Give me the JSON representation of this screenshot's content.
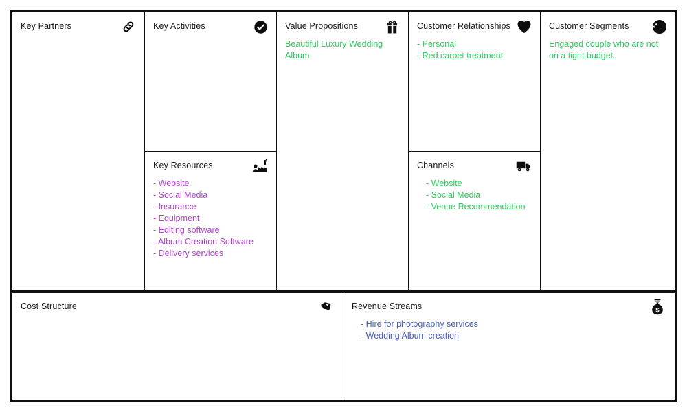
{
  "document": {
    "type": "Business Model Canvas",
    "subject": "Wedding Photography Business"
  },
  "colors": {
    "green": "#2ecc5e",
    "purple": "#b044cf",
    "blue": "#4a5ec0",
    "border": "#111111",
    "title": "#1a1a1a",
    "background": "#ffffff"
  },
  "blocks": {
    "key_partners": {
      "title": "Key Partners",
      "icon": "link-chain-icon",
      "items": [],
      "text_color": "#2ecc5e"
    },
    "key_activities": {
      "title": "Key Activities",
      "icon": "check-circle-icon",
      "items": [],
      "text_color": "#2ecc5e"
    },
    "key_resources": {
      "title": "Key Resources",
      "icon": "factory-worker-icon",
      "items": [
        "- Website",
        "- Social Media",
        "- Insurance",
        "- Equipment",
        "- Editing software",
        "- Album Creation Software",
        "- Delivery services"
      ],
      "text_color": "#b044cf"
    },
    "value_propositions": {
      "title": "Value Propositions",
      "icon": "gift-box-icon",
      "items": [
        "Beautiful Luxury Wedding Album"
      ],
      "text_color": "#2ecc5e"
    },
    "customer_relationships": {
      "title": "Customer Relationships",
      "icon": "heart-icon",
      "items": [
        "- Personal",
        "- Red carpet treatment"
      ],
      "text_color": "#2ecc5e"
    },
    "channels": {
      "title": "Channels",
      "icon": "delivery-truck-icon",
      "items": [
        "- Website",
        "- Social Media",
        "- Venue Recommendation"
      ],
      "text_color": "#2ecc5e"
    },
    "customer_segments": {
      "title": "Customer Segments",
      "icon": "customer-head-icon",
      "items": [
        "Engaged couple who are not on a tight budget."
      ],
      "text_color": "#2ecc5e"
    },
    "cost_structure": {
      "title": "Cost Structure",
      "icon": "price-tag-icon",
      "items": [],
      "text_color": "#4a5ec0"
    },
    "revenue_streams": {
      "title": "Revenue Streams",
      "icon": "money-bag-icon",
      "items": [
        "- Hire for photography services",
        "- Wedding Album creation"
      ],
      "text_color": "#4a5ec0"
    }
  }
}
